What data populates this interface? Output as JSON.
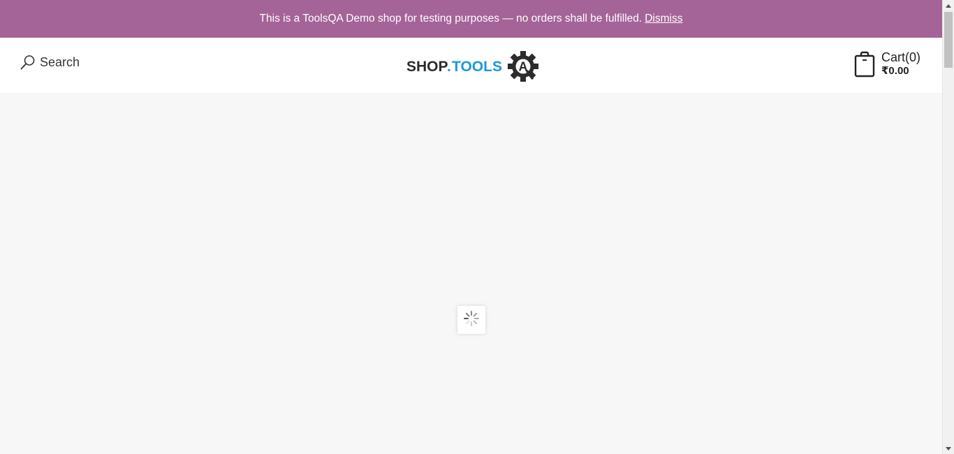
{
  "demo_banner": {
    "message": "This is a ToolsQA Demo shop for testing purposes — no orders shall be fulfilled.",
    "dismiss_label": "Dismiss",
    "background_color": "#a46497"
  },
  "header": {
    "search_label": "Search",
    "search_icon": "search-icon",
    "logo": {
      "word_shop": "SHOP",
      "word_dot": ".",
      "word_tools": "TOOLS",
      "emblem_letter": "A",
      "dark_color": "#2b2b2b",
      "accent_color": "#1a9bd7"
    },
    "cart": {
      "title": "Cart(0)",
      "total": "₹0.00",
      "icon": "shopping-bag-icon"
    }
  },
  "main": {
    "loading": true,
    "loader_icon": "spinner-icon"
  },
  "scrollbar": {
    "up_icon": "scroll-up-icon",
    "down_icon": "scroll-down-icon"
  }
}
